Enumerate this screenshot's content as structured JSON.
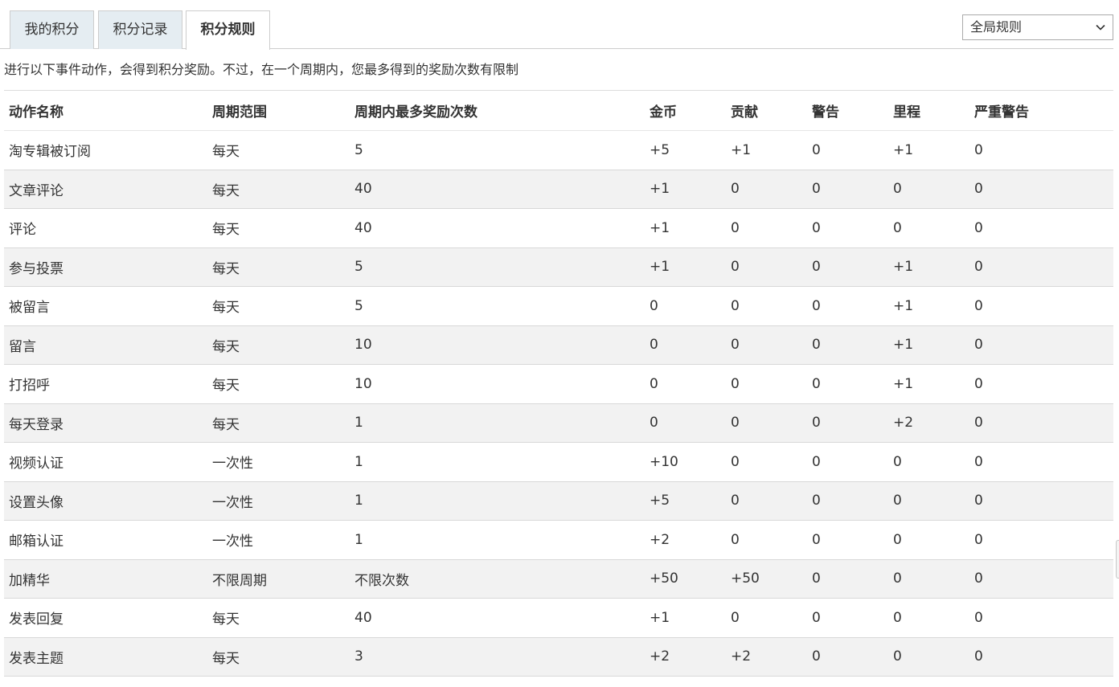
{
  "tabs": [
    {
      "label": "我的积分",
      "active": false
    },
    {
      "label": "积分记录",
      "active": false
    },
    {
      "label": "积分规则",
      "active": true
    }
  ],
  "scope_select": {
    "selected": "全局规则",
    "icon": "chevron-down-icon"
  },
  "notice": "进行以下事件动作，会得到积分奖励。不过，在一个周期内，您最多得到的奖励次数有限制",
  "table": {
    "headers": [
      "动作名称",
      "周期范围",
      "周期内最多奖励次数",
      "金币",
      "贡献",
      "警告",
      "里程",
      "严重警告"
    ],
    "rows": [
      [
        "淘专辑被订阅",
        "每天",
        "5",
        "+5",
        "+1",
        "0",
        "+1",
        "0"
      ],
      [
        "文章评论",
        "每天",
        "40",
        "+1",
        "0",
        "0",
        "0",
        "0"
      ],
      [
        "评论",
        "每天",
        "40",
        "+1",
        "0",
        "0",
        "0",
        "0"
      ],
      [
        "参与投票",
        "每天",
        "5",
        "+1",
        "0",
        "0",
        "+1",
        "0"
      ],
      [
        "被留言",
        "每天",
        "5",
        "0",
        "0",
        "0",
        "+1",
        "0"
      ],
      [
        "留言",
        "每天",
        "10",
        "0",
        "0",
        "0",
        "+1",
        "0"
      ],
      [
        "打招呼",
        "每天",
        "10",
        "0",
        "0",
        "0",
        "+1",
        "0"
      ],
      [
        "每天登录",
        "每天",
        "1",
        "0",
        "0",
        "0",
        "+2",
        "0"
      ],
      [
        "视频认证",
        "一次性",
        "1",
        "+10",
        "0",
        "0",
        "0",
        "0"
      ],
      [
        "设置头像",
        "一次性",
        "1",
        "+5",
        "0",
        "0",
        "0",
        "0"
      ],
      [
        "邮箱认证",
        "一次性",
        "1",
        "+2",
        "0",
        "0",
        "0",
        "0"
      ],
      [
        "加精华",
        "不限周期",
        "不限次数",
        "+50",
        "+50",
        "0",
        "0",
        "0"
      ],
      [
        "发表回复",
        "每天",
        "40",
        "+1",
        "0",
        "0",
        "0",
        "0"
      ],
      [
        "发表主题",
        "每天",
        "3",
        "+2",
        "+2",
        "0",
        "0",
        "0"
      ]
    ]
  },
  "colors": {
    "tab_inactive_bg": "#e5edf2",
    "row_alt_bg": "#f2f2f2",
    "text": "#333333"
  }
}
